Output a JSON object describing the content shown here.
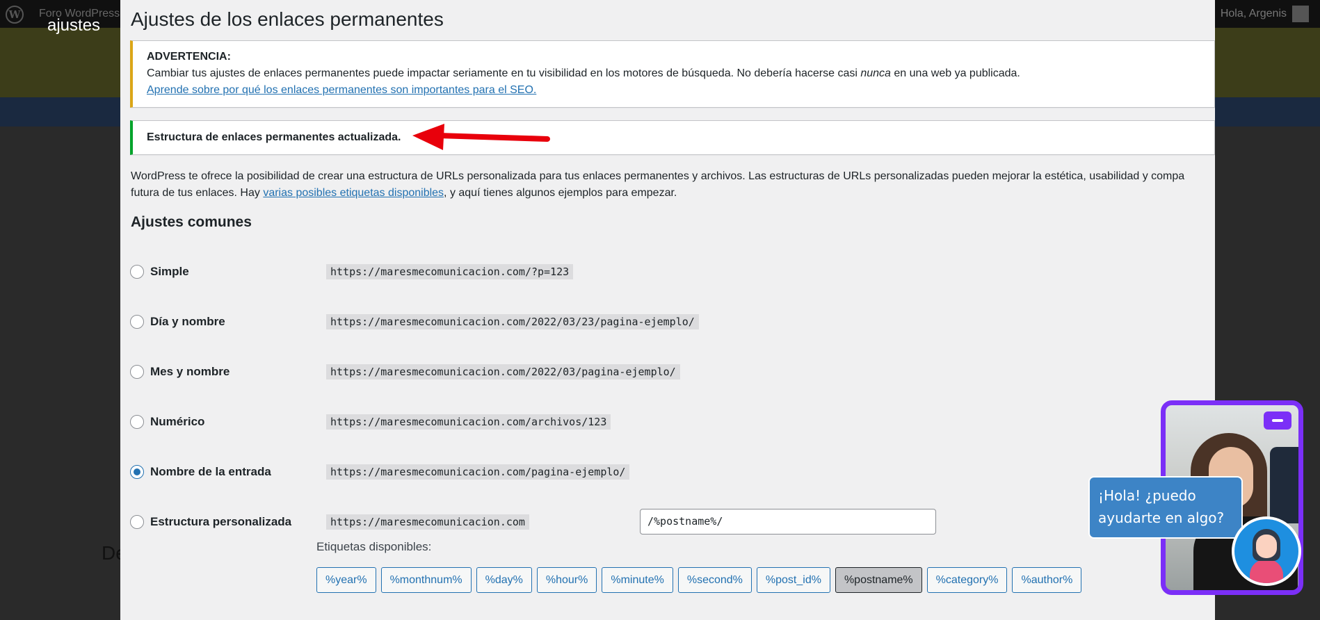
{
  "background": {
    "adminbar": {
      "site_name": "Foro WordPress",
      "greeting": "Hola, Argenis"
    },
    "caption": "ajustes",
    "left_text": "De"
  },
  "page": {
    "title": "Ajustes de los enlaces permanentes",
    "warning": {
      "heading": "ADVERTENCIA:",
      "body_before": "Cambiar tus ajustes de enlaces permanentes puede impactar seriamente en tu visibilidad en los motores de búsqueda. No debería hacerse casi ",
      "body_emphasis": "nunca",
      "body_after": " en una web ya publicada.",
      "link": "Aprende sobre por qué los enlaces permanentes son importantes para el SEO."
    },
    "success": {
      "message": "Estructura de enlaces permanentes actualizada."
    },
    "intro": {
      "line1": "WordPress te ofrece la posibilidad de crear una estructura de URLs personalizada para tus enlaces permanentes y archivos. Las estructuras de URLs personalizadas pueden mejorar la estética, usabilidad y compa",
      "line2_before": "futura de tus enlaces. Hay ",
      "line2_link": "varias posibles etiquetas disponibles",
      "line2_after": ", y aquí tienes algunos ejemplos para empezar."
    },
    "section_heading": "Ajustes comunes",
    "options": [
      {
        "label": "Simple",
        "example": "https://maresmecomunicacion.com/?p=123",
        "checked": false
      },
      {
        "label": "Día y nombre",
        "example": "https://maresmecomunicacion.com/2022/03/23/pagina-ejemplo/",
        "checked": false
      },
      {
        "label": "Mes y nombre",
        "example": "https://maresmecomunicacion.com/2022/03/pagina-ejemplo/",
        "checked": false
      },
      {
        "label": "Numérico",
        "example": "https://maresmecomunicacion.com/archivos/123",
        "checked": false
      },
      {
        "label": "Nombre de la entrada",
        "example": "https://maresmecomunicacion.com/pagina-ejemplo/",
        "checked": true
      },
      {
        "label": "Estructura personalizada",
        "example": "https://maresmecomunicacion.com",
        "checked": false
      }
    ],
    "custom_structure_value": "/%postname%/",
    "tags_label": "Etiquetas disponibles:",
    "tags": [
      "%year%",
      "%monthnum%",
      "%day%",
      "%hour%",
      "%minute%",
      "%second%",
      "%post_id%",
      "%postname%",
      "%category%",
      "%author%"
    ],
    "active_tag": "%postname%"
  },
  "chat": {
    "bubble_line1": "¡Hola! ¿puedo",
    "bubble_line2": "ayudarte en algo?"
  },
  "colors": {
    "accent": "#2271b1",
    "warning_border": "#dba617",
    "success_border": "#00a32a",
    "widget_purple": "#7b2ff7",
    "chat_bubble": "#3d84c6",
    "arrow": "#e8000b"
  }
}
